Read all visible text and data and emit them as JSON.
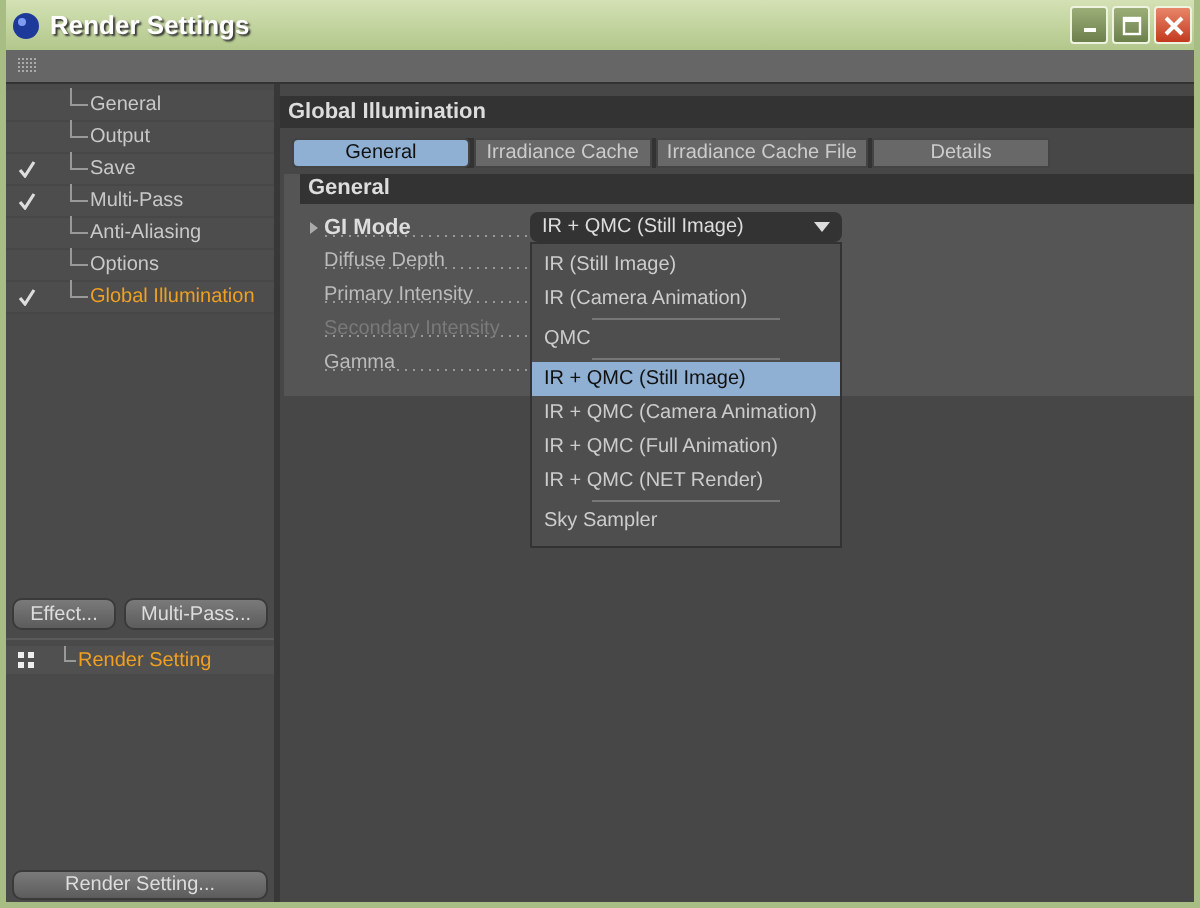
{
  "window": {
    "title": "Render Settings"
  },
  "sidebar": {
    "items": [
      {
        "label": "General",
        "checked": false,
        "selected": false
      },
      {
        "label": "Output",
        "checked": false,
        "selected": false
      },
      {
        "label": "Save",
        "checked": true,
        "selected": false
      },
      {
        "label": "Multi-Pass",
        "checked": true,
        "selected": false
      },
      {
        "label": "Anti-Aliasing",
        "checked": false,
        "selected": false
      },
      {
        "label": "Options",
        "checked": false,
        "selected": false
      },
      {
        "label": "Global Illumination",
        "checked": true,
        "selected": true
      }
    ],
    "buttons": [
      "Effect...",
      "Multi-Pass..."
    ],
    "tree": [
      {
        "label": "Render Setting",
        "selected": true
      }
    ],
    "bottom_button": "Render Setting..."
  },
  "panel": {
    "title": "Global Illumination",
    "tabs": [
      {
        "label": "General",
        "selected": true
      },
      {
        "label": "Irradiance Cache",
        "selected": false
      },
      {
        "label": "Irradiance Cache File",
        "selected": false
      },
      {
        "label": "Details",
        "selected": false
      }
    ],
    "section": "General",
    "params": [
      {
        "label": "GI Mode",
        "kind": "dropdown",
        "value": "IR + QMC (Still Image)",
        "disabled": false,
        "expanded": true
      },
      {
        "label": "Diffuse Depth",
        "kind": "field",
        "disabled": false
      },
      {
        "label": "Primary Intensity",
        "kind": "field",
        "disabled": false
      },
      {
        "label": "Secondary Intensity",
        "kind": "field",
        "disabled": true
      },
      {
        "label": "Gamma",
        "kind": "field",
        "disabled": false
      }
    ],
    "menu": [
      {
        "kind": "option",
        "label": "IR (Still Image)",
        "selected": false
      },
      {
        "kind": "option",
        "label": "IR (Camera Animation)",
        "selected": false
      },
      {
        "kind": "separator"
      },
      {
        "kind": "option",
        "label": "QMC",
        "selected": false
      },
      {
        "kind": "separator"
      },
      {
        "kind": "option",
        "label": "IR + QMC (Still Image)",
        "selected": true
      },
      {
        "kind": "option",
        "label": "IR + QMC (Camera Animation)",
        "selected": false
      },
      {
        "kind": "option",
        "label": "IR + QMC (Full Animation)",
        "selected": false
      },
      {
        "kind": "option",
        "label": "IR + QMC (NET Render)",
        "selected": false
      },
      {
        "kind": "separator"
      },
      {
        "kind": "option",
        "label": "Sky Sampler",
        "selected": false
      }
    ]
  }
}
